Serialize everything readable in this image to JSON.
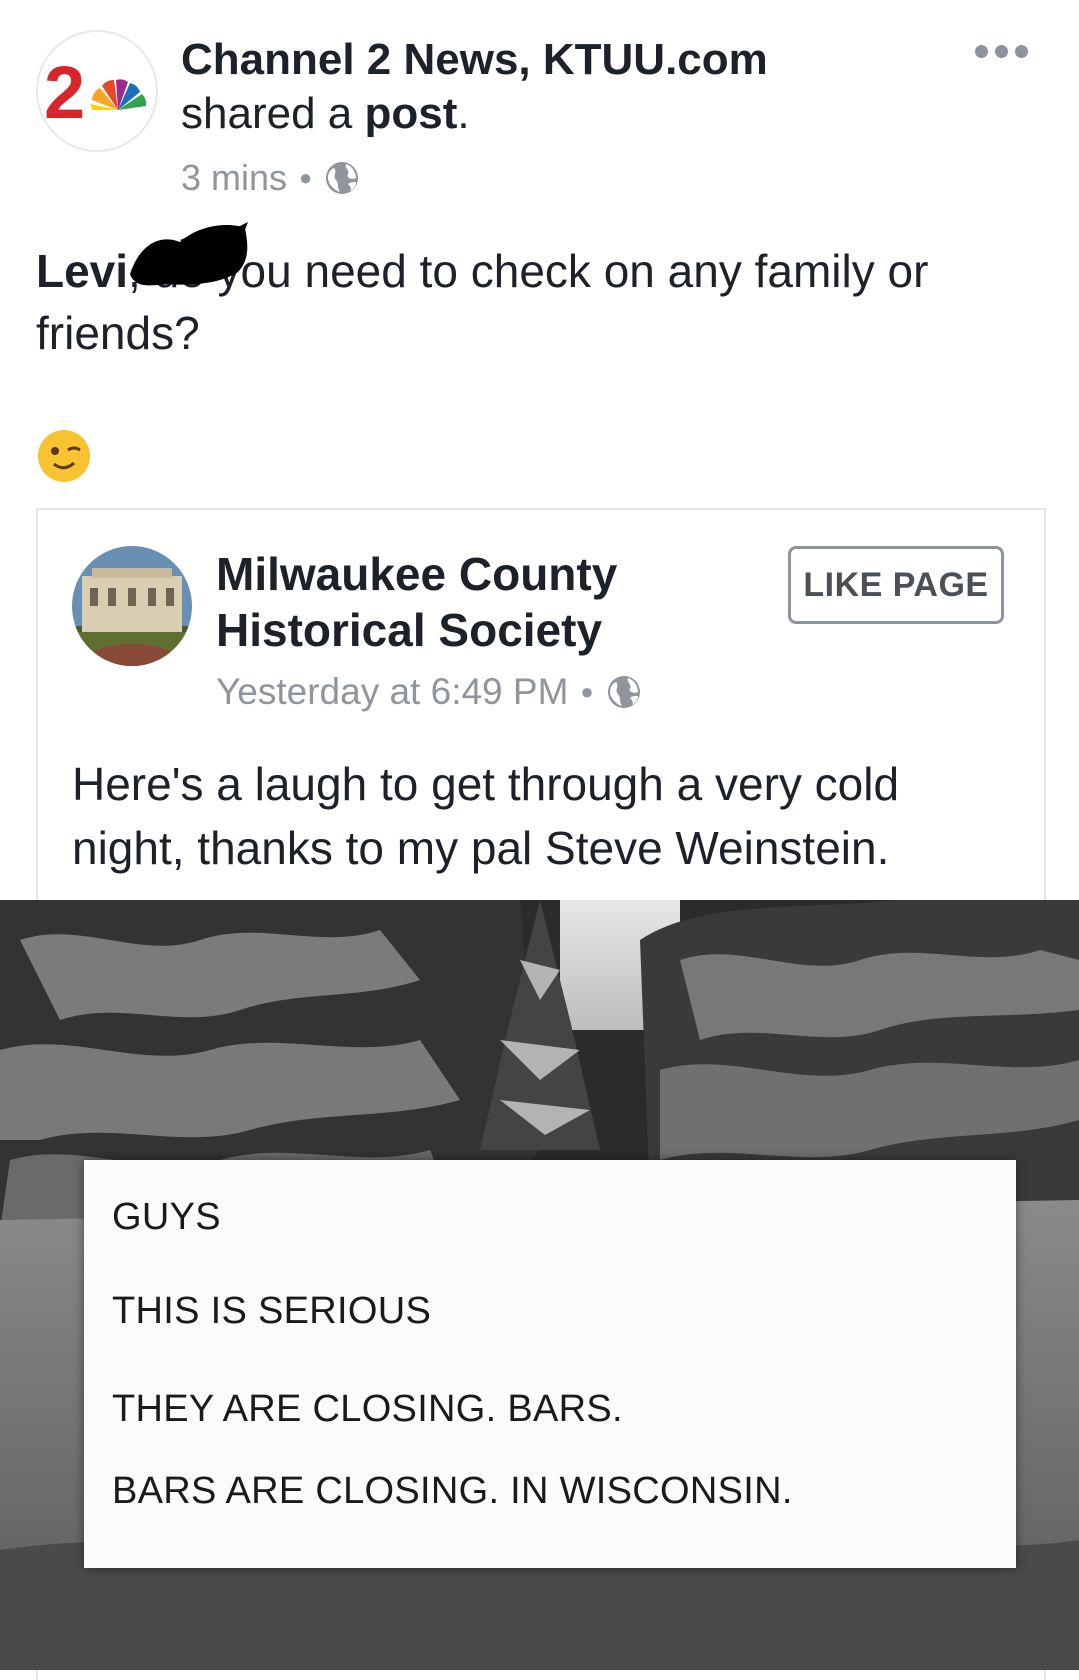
{
  "shared_post": {
    "poster_name": "Channel 2 News, KTUU.com",
    "shared_prefix": "shared a ",
    "shared_link": "post",
    "shared_suffix": ".",
    "time": "3 mins",
    "message_mention": "Levi",
    "message_text": ", do you need to check on any family or friends?",
    "logo_text": "2"
  },
  "embedded_post": {
    "page_name": "Milwaukee County Historical Society",
    "like_button": "LIKE PAGE",
    "time": "Yesterday at 6:49 PM",
    "text": "Here's a laugh to get through a very cold night, thanks to my pal Steve Weinstein."
  },
  "image_note": {
    "lines": [
      "GUYS",
      "THIS IS SERIOUS",
      "THEY ARE CLOSING. BARS.",
      "BARS ARE CLOSING. IN WISCONSIN."
    ]
  },
  "colors": {
    "text": "#1d2129",
    "meta": "#90949c",
    "nbc_red": "#d7262b"
  }
}
